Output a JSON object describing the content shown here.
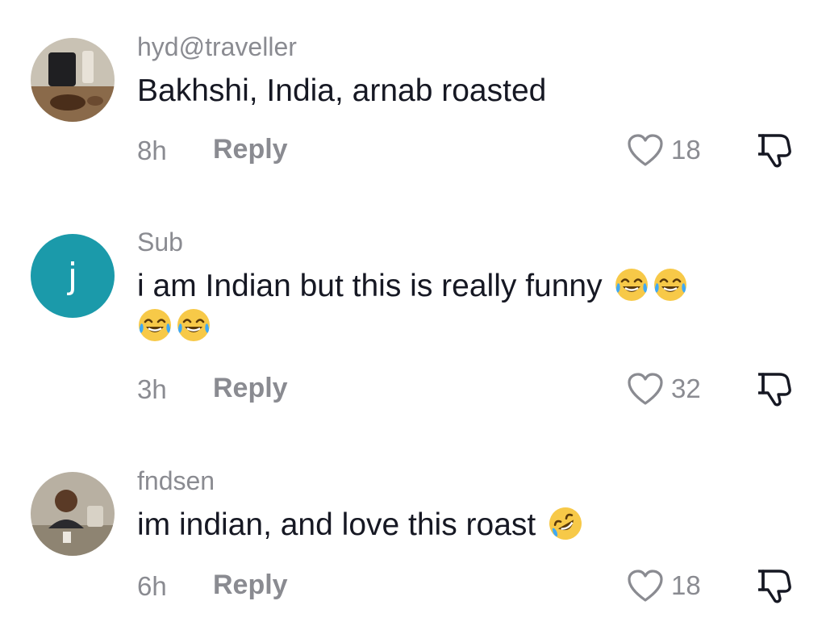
{
  "colors": {
    "primary_text": "#161823",
    "secondary_text": "#8a8b91",
    "avatar_teal": "#1b9aaa",
    "background": "#ffffff"
  },
  "comments": [
    {
      "username": "hyd@traveller",
      "avatar": "photo-avatar",
      "text": "Bakhshi, India, arnab roasted",
      "emoji": [],
      "time": "8h",
      "reply_label": "Reply",
      "likes": "18"
    },
    {
      "username": "Sub",
      "avatar_letter": "j",
      "text_line1": "i am Indian but this is really funny",
      "emoji": [
        "face-with-tears-of-joy",
        "face-with-tears-of-joy",
        "face-with-tears-of-joy",
        "face-with-tears-of-joy"
      ],
      "time": "3h",
      "reply_label": "Reply",
      "likes": "32"
    },
    {
      "username": "fndsen",
      "avatar": "photo-avatar",
      "text": "im indian, and love this roast",
      "emoji": [
        "rolling-on-the-floor-laughing"
      ],
      "time": "6h",
      "reply_label": "Reply",
      "likes": "18"
    }
  ]
}
